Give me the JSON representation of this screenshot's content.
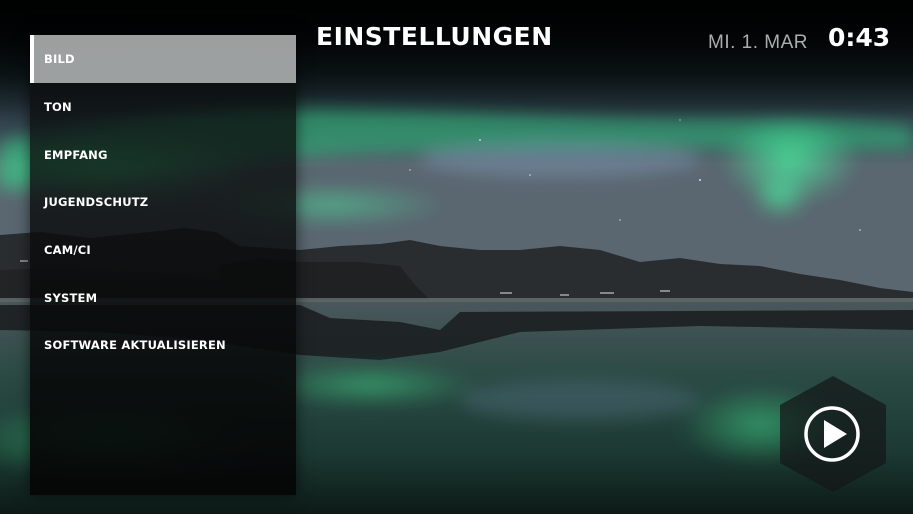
{
  "header": {
    "title": "EINSTELLUNGEN",
    "date": "MI. 1. MAR",
    "time": "0:43"
  },
  "menu": {
    "items": [
      {
        "label": "BILD",
        "active": true
      },
      {
        "label": "TON",
        "active": false
      },
      {
        "label": "EMPFANG",
        "active": false
      },
      {
        "label": "JUGENDSCHUTZ",
        "active": false
      },
      {
        "label": "CAM/CI",
        "active": false
      },
      {
        "label": "SYSTEM",
        "active": false
      },
      {
        "label": "SOFTWARE AKTUALISIEREN",
        "active": false
      }
    ]
  },
  "play_button": {
    "icon": "play-icon"
  },
  "colors": {
    "active_item_bg": "#aaacac",
    "aurora_green": "#3fe08a",
    "text": "#ffffff",
    "date_text": "#a9adad"
  }
}
